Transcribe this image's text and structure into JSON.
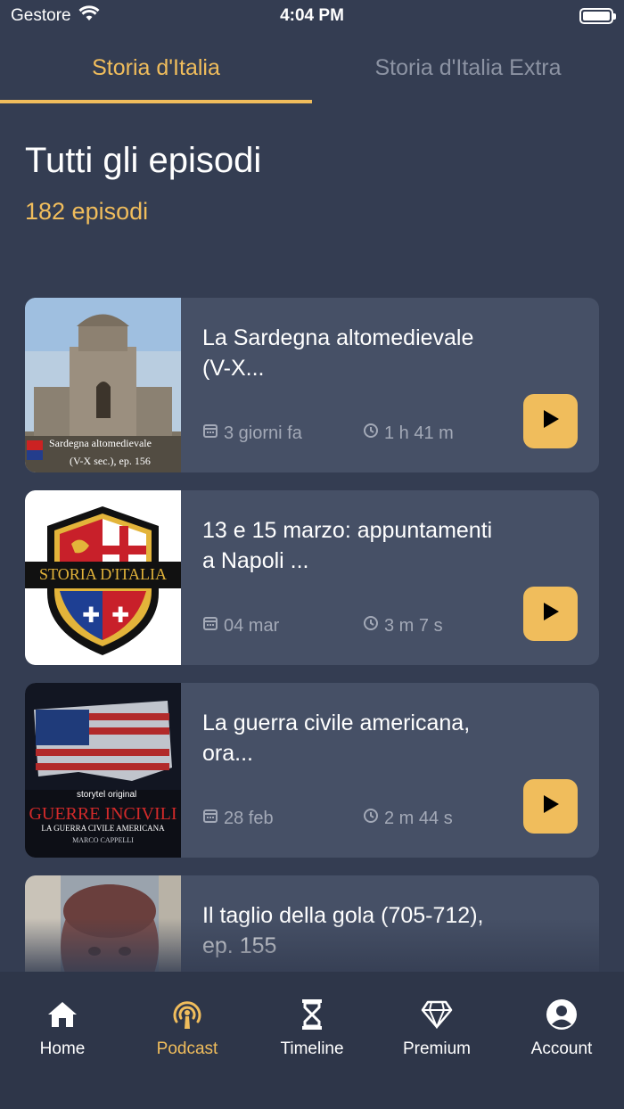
{
  "status_bar": {
    "carrier": "Gestore",
    "time": "4:04 PM"
  },
  "tabs": [
    {
      "label": "Storia d'Italia",
      "active": true
    },
    {
      "label": "Storia d'Italia Extra",
      "active": false
    }
  ],
  "header": {
    "title": "Tutti gli episodi",
    "count": "182 episodi"
  },
  "episodes": [
    {
      "title": "La Sardegna altomedievale (V-X...",
      "date": "3 giorni fa",
      "duration": "1 h 41 m",
      "thumb_caption_1": "Sardegna altomedievale",
      "thumb_caption_2": "(V-X sec.), ep. 156"
    },
    {
      "title": "13 e 15 marzo: appuntamenti a Napoli ...",
      "date": "04 mar",
      "duration": "3 m 7 s",
      "thumb_caption_1": "STORIA D'ITALIA"
    },
    {
      "title": "La guerra civile americana, ora...",
      "date": "28 feb",
      "duration": "2 m 44 s",
      "thumb_caption_1": "storytel original",
      "thumb_caption_2": "GUERRE INCIVILI",
      "thumb_caption_3": "LA GUERRA CIVILE AMERICANA",
      "thumb_caption_4": "MARCO CAPPELLI"
    },
    {
      "title": "Il taglio della gola (705-712), ep. 155",
      "date": "",
      "duration": ""
    }
  ],
  "nav": [
    {
      "label": "Home",
      "icon": "home-icon",
      "active": false
    },
    {
      "label": "Podcast",
      "icon": "podcast-icon",
      "active": true
    },
    {
      "label": "Timeline",
      "icon": "hourglass-icon",
      "active": false
    },
    {
      "label": "Premium",
      "icon": "diamond-icon",
      "active": false
    },
    {
      "label": "Account",
      "icon": "account-icon",
      "active": false
    }
  ],
  "colors": {
    "background": "#343d52",
    "card": "#465066",
    "accent": "#f0bd5c",
    "nav": "#2e3649"
  }
}
